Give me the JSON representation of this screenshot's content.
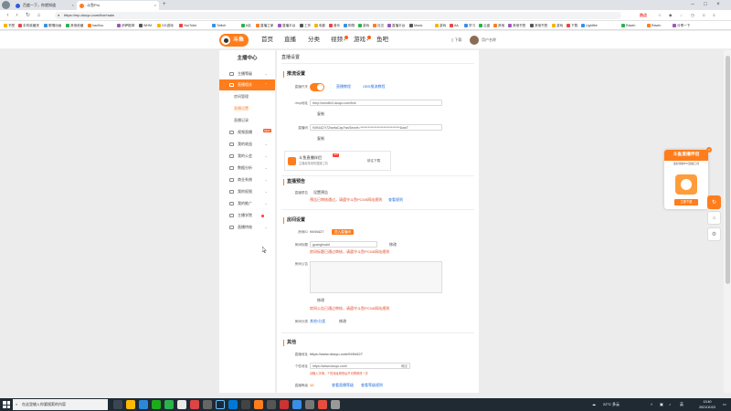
{
  "browser": {
    "tabs": [
      {
        "label": "百度一下，你就知道",
        "active": false
      },
      {
        "label": "斗鱼Pro",
        "active": true
      }
    ],
    "url": "https://mp.douyu.com/live/main",
    "news_label": "热点"
  },
  "bookmarks": [
    "书签",
    "手机收藏夹",
    "歌唱动画",
    "其他收藏",
    "haoSou",
    "伊萨推荐",
    "WHM",
    "GG游戏",
    "YouTube",
    "Twitch",
    "b站",
    "直播之家",
    "直播平台",
    "工作",
    "电影",
    "音乐",
    "购物",
    "游戏",
    "社交",
    "直播平台",
    "Music",
    "游戏",
    "AA",
    "学习",
    "云盘",
    "其他",
    "其他书签",
    "其他书签",
    "游戏",
    "下载",
    "Lightfire",
    "Raven",
    "Raven",
    "分享一下"
  ],
  "site": {
    "logo_text": "斗鱼",
    "nav": [
      "首页",
      "直播",
      "分类",
      "视频",
      "游戏",
      "鱼吧"
    ],
    "download_label": "下载",
    "user_name": "用户名称"
  },
  "sidebar": {
    "title": "主播中心",
    "items": [
      {
        "label": "主播等级",
        "active": false
      },
      {
        "label": "直播相关",
        "active": true
      },
      {
        "label": "视频直播",
        "active": false
      },
      {
        "label": "我的收益",
        "active": false
      },
      {
        "label": "我的公会",
        "active": false
      },
      {
        "label": "数据分析",
        "active": false
      },
      {
        "label": "商业系统",
        "active": false
      },
      {
        "label": "我的权限",
        "active": false
      },
      {
        "label": "我的推广",
        "active": false
      },
      {
        "label": "主播学院",
        "active": false
      },
      {
        "label": "直播特效",
        "active": false
      }
    ],
    "subitems": [
      {
        "label": "房间管理",
        "active": false
      },
      {
        "label": "直播设置",
        "active": true
      },
      {
        "label": "直播记录",
        "active": false
      }
    ],
    "badge": "NEW"
  },
  "main": {
    "page_title": "直播设置",
    "push": {
      "title": "推流设置",
      "toggle_label": "直播开关",
      "link1": "直播教程",
      "link2": "OBS推流教程",
      "rtmp_label": "rtmp地址",
      "rtmp_value": "rtmp://sendfc3.douyu.com/live",
      "copy1": "复制",
      "code_label": "直播码",
      "code_value": "9494427r7ZwetaCap?wsSecret=*******************************&wsT",
      "copy2": "复制",
      "promo_title": "斗鱼直播伴侣",
      "promo_sub": "主播最常用的直播工具",
      "promo_badge": "HOT",
      "promo_download": "前往下载"
    },
    "notice": {
      "title": "直播预告",
      "label": "直播预告",
      "set_link": "设置预告",
      "warning": "预告已审核通过，请遵守斗鱼PC5/6网站规则",
      "view_link": "查看规则"
    },
    "room": {
      "title": "房间设置",
      "room_id_label": "房间ID",
      "room_id": "9494427",
      "enter_room": "进入直播间",
      "title_label": "房间标题",
      "title_value": "guanghuaid",
      "modify1": "修改",
      "title_warning": "房间标题已通过审核，请遵守斗鱼PC5/6网站规则",
      "notice_label": "房间公告",
      "modify2": "修改",
      "notice_warning": "房间公告已通过审核，请遵守斗鱼PC5/6网站规则",
      "cat_label": "房间分类",
      "cat_link": "其他/分类",
      "cat_modify": "修改"
    },
    "other": {
      "title": "其他",
      "link_label": "直播地址",
      "link_value": "https://www.douyu.com/9494427",
      "custom_label": "个性地址",
      "custom_value": "https://www.douyu.com/",
      "custom_suffix": "确定",
      "custom_warning": "请输入字母，个性地址修改后不可再修改一次",
      "level_label": "直播等级",
      "level_value": "12",
      "level_link1": "查看直播等级",
      "level_link2": "查看等级规则"
    }
  },
  "float_ad": {
    "title": "斗鱼直播伴侣",
    "sub": "最好用的PC直播工具",
    "button": "立即下载",
    "close": "×"
  },
  "taskbar": {
    "search_placeholder": "在这里输入你要搜索的内容",
    "tray_text": "22°C 多云",
    "lang": "英",
    "time": "13:40",
    "date": "2021/11/23"
  }
}
